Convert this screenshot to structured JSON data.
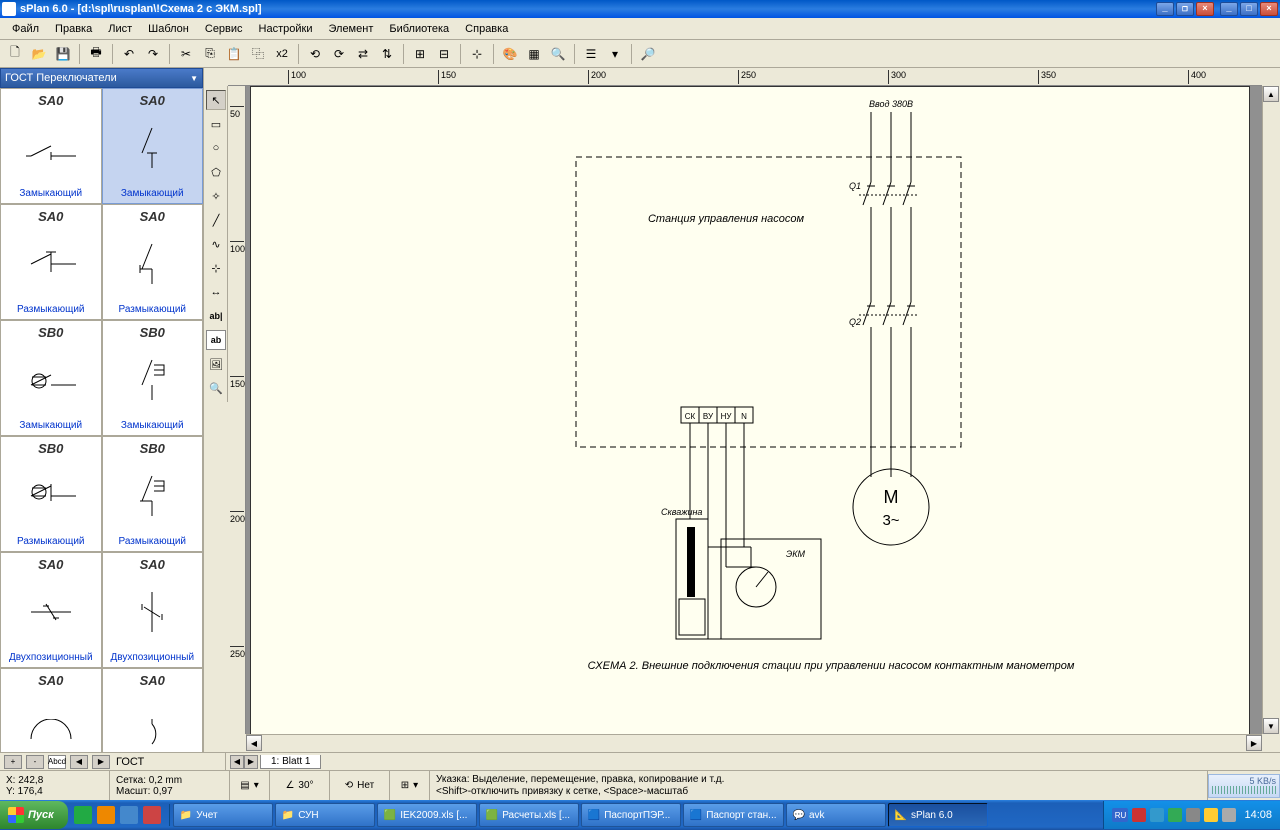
{
  "title": "sPlan 6.0 - [d:\\spl\\rusplan\\!Схема 2 с ЭКМ.spl]",
  "menu": [
    "Файл",
    "Правка",
    "Лист",
    "Шаблон",
    "Сервис",
    "Настройки",
    "Элемент",
    "Библиотека",
    "Справка"
  ],
  "toolbar_x2": "x2",
  "category": "ГОСТ Переключатели",
  "components": [
    {
      "id": "SA0",
      "label": "Замыкающий"
    },
    {
      "id": "SA0",
      "label": "Замыкающий",
      "selected": true
    },
    {
      "id": "SA0",
      "label": "Размыкающий"
    },
    {
      "id": "SA0",
      "label": "Размыкающий"
    },
    {
      "id": "SB0",
      "label": "Замыкающий"
    },
    {
      "id": "SB0",
      "label": "Замыкающий"
    },
    {
      "id": "SB0",
      "label": "Размыкающий"
    },
    {
      "id": "SB0",
      "label": "Размыкающий"
    },
    {
      "id": "SA0",
      "label": "Двухпозиционный"
    },
    {
      "id": "SA0",
      "label": "Двухпозиционный"
    },
    {
      "id": "SA0",
      "label": ""
    },
    {
      "id": "SA0",
      "label": ""
    }
  ],
  "ruler_h": [
    "100",
    "150",
    "200",
    "250",
    "300",
    "350",
    "400"
  ],
  "ruler_v": [
    "50",
    "100",
    "150",
    "200",
    "250"
  ],
  "diagram": {
    "title_top": "Ввод 380В",
    "box_label": "Станция управления насосом",
    "terminals": [
      "СК",
      "ВУ",
      "НУ",
      "N"
    ],
    "q1": "Q1",
    "q2": "Q2",
    "motor_top": "M",
    "motor_bot": "3~",
    "well": "Скважина",
    "ekm": "ЭКМ",
    "caption": "СХЕМА 2. Внешние подключения стации при управлении насосом контактным манометром"
  },
  "library_label": "ГОСТ",
  "page_tab": "1: Blatt 1",
  "status": {
    "x": "X: 242,8",
    "y": "Y: 176,4",
    "grid": "Сетка:  0,2 mm",
    "scale": "Масшт:  0,97",
    "angle": "30°",
    "snap": "Нет",
    "hint": "Указка: Выделение, перемещение, правка, копирование и т.д.\n<Shift>-отключить привязку к сетке, <Space>-масштаб",
    "net": "5 KB/s"
  },
  "taskbar": {
    "start": "Пуск",
    "tasks": [
      "Учет",
      "СУН",
      "IEK2009.xls  [...",
      "Расчеты.xls  [...",
      "ПаспортПЭР...",
      "Паспорт стан...",
      "avk",
      "sPlan 6.0"
    ],
    "lang": "RU",
    "time": "14:08"
  }
}
